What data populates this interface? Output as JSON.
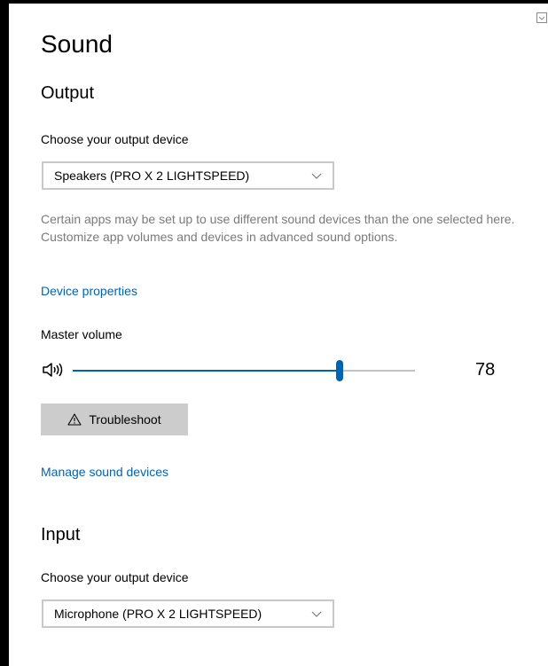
{
  "page": {
    "title": "Sound"
  },
  "output": {
    "heading": "Output",
    "device_label": "Choose your output device",
    "device_selected": "Speakers (PRO X 2 LIGHTSPEED)",
    "helper_text": "Certain apps may be set up to use different sound devices than the one selected here. Customize app volumes and devices in advanced sound options.",
    "device_properties_link": "Device properties",
    "volume_label": "Master volume",
    "volume_value": "78",
    "volume_fraction": 0.78,
    "troubleshoot_label": "Troubleshoot",
    "manage_devices_link": "Manage sound devices"
  },
  "input": {
    "heading": "Input",
    "device_label": "Choose your output device",
    "device_selected": "Microphone (PRO X 2 LIGHTSPEED)"
  },
  "colors": {
    "accent": "#0063b1",
    "helper_text": "#7a7a7a",
    "button_bg": "#cccccc",
    "track": "#c2c2c2"
  },
  "icons": {
    "volume": "speaker-volume-icon",
    "dropdown": "chevron-down-icon",
    "warning": "warning-triangle-icon",
    "corner": "window-corner-icon"
  }
}
